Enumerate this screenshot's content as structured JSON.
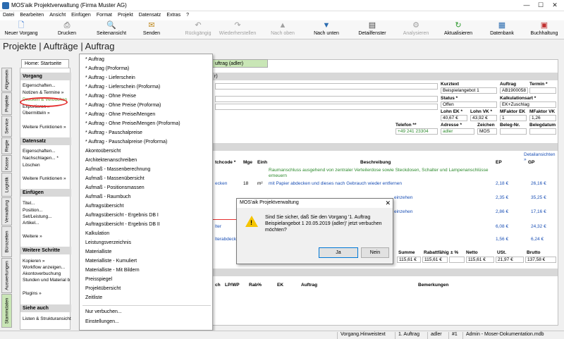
{
  "window": {
    "title": "MOS'aik Projektverwaltung (Firma Muster AG)",
    "minimize": "—",
    "maximize": "☐",
    "close": "✕"
  },
  "menubar": [
    "Datei",
    "Bearbeiten",
    "Ansicht",
    "Einfügen",
    "Format",
    "Projekt",
    "Datensatz",
    "Extras",
    "?"
  ],
  "toolbar": [
    {
      "label": "Neuer Vorgang",
      "icon": "new-document-icon",
      "enabled": true
    },
    {
      "label": "Drucken",
      "icon": "printer-icon",
      "enabled": true
    },
    {
      "label": "Seitenansicht",
      "icon": "print-preview-icon",
      "enabled": true
    },
    {
      "label": "Senden",
      "icon": "send-mail-icon",
      "enabled": true
    },
    {
      "label": "Rückgängig",
      "icon": "undo-icon",
      "enabled": false
    },
    {
      "label": "Wiederherstellen",
      "icon": "redo-icon",
      "enabled": false
    },
    {
      "label": "Nach oben",
      "icon": "arrow-up-icon",
      "enabled": false
    },
    {
      "label": "Nach unten",
      "icon": "arrow-down-icon",
      "enabled": true
    },
    {
      "label": "Detailfenster",
      "icon": "detail-window-icon",
      "enabled": true
    },
    {
      "label": "Analysieren",
      "icon": "analyze-icon",
      "enabled": false
    },
    {
      "label": "Aktualisieren",
      "icon": "refresh-icon",
      "enabled": true
    },
    {
      "label": "Datenbank",
      "icon": "database-icon",
      "enabled": true
    },
    {
      "label": "Buchhaltung",
      "icon": "accounting-icon",
      "enabled": true
    }
  ],
  "page_title": "Projekte | Aufträge | Auftrag",
  "home_tab": "Home: Startseite",
  "doc_tab": "uftrag (adler)",
  "side_tabs": [
    "Allgemein",
    "Projekte",
    "Service",
    "Regie",
    "Kasse",
    "Logistik",
    "Verwaltung",
    "Bürozeiten",
    "Auswertungen",
    "Stammdaten"
  ],
  "nav": {
    "vorgang_head": "Vorgang",
    "vorgang_items": [
      "Eigenschaften...",
      "Notizen & Termine »",
      "Drucken & Verbuchen",
      "Exportieren »",
      "Übermitteln »"
    ],
    "vorgang_more": "Weitere Funktionen »",
    "datensatz_head": "Datensatz",
    "datensatz_items": [
      "Eigenschaften...",
      "Nachschlagen... *",
      "Löschen"
    ],
    "datensatz_more": "Weitere Funktionen »",
    "einfuegen_head": "Einfügen",
    "einfuegen_items": [
      "Titel...",
      "Position...",
      "Set/Leistung...",
      "Artikel..."
    ],
    "einfuegen_more": "Weitere »",
    "schritte_head": "Weitere Schritte",
    "schritte_items": [
      "Kopieren »",
      "Workflow anzeigen...",
      "Akontoverbuchung",
      "Stunden und Material b"
    ],
    "schritte_more": "Plugins »",
    "siehe_head": "Siehe auch",
    "siehe_items": [
      "Listen & Strukturansicht"
    ]
  },
  "context_menu": {
    "items": [
      "* Auftrag",
      "* Auftrag (Proforma)",
      "* Auftrag - Lieferschein",
      "* Auftrag - Lieferschein (Proforma)",
      "* Auftrag - Ohne Preise",
      "* Auftrag - Ohne Preise (Proforma)",
      "* Auftrag - Ohne Preise/Mengen",
      "* Auftrag - Ohne Preise/Mengen (Proforma)",
      "* Auftrag - Pauschalpreise",
      "* Auftrag - Pauschalpreise (Proforma)",
      "Akontoübersicht",
      "Architektenanschreiben",
      "Aufmaß - Massenberechnung",
      "Aufmaß - Massenübersicht",
      "Aufmaß - Positionsmassen",
      "Aufmaß - Raumbuch",
      "Auftragsübersicht",
      "Auftragsübersicht - Ergebnis DB I",
      "Auftragsübersicht - Ergebnis DB II",
      "Kalkulation",
      "Leistungsverzeichnis",
      "Materialliste",
      "Materialliste - Kumuliert",
      "Materialliste - Mit Bildern",
      "Preisspiegel",
      "Projektübersicht",
      "Zeitliste"
    ],
    "extra": [
      "Nur verbuchen...",
      "Einstellungen..."
    ]
  },
  "header": {
    "section": "r)",
    "kurztext_label": "Kurztext",
    "kurztext": "Beispielangebot 1",
    "auftrag_label": "Auftrag",
    "auftrag": "AB1900058",
    "termin_label": "Termin *",
    "status_label": "Status *",
    "status": "Offen",
    "kalk_label": "Kalkulationsart *",
    "kalk": "EK+Zuschlag",
    "lohn_ek_label": "Lohn EK *",
    "lohn_ek": "40,67 €",
    "lohn_vk_label": "Lohn VK *",
    "lohn_vk": "43,92 €",
    "mf_ek_label": "MFaktor EK",
    "mf_ek": "1",
    "mf_vk_label": "MFaktor VK",
    "mf_vk": "1,26",
    "telefon_label": "Telefon **",
    "telefon": "+49 241 23304",
    "adresse_label": "Adresse *",
    "adresse": "adler",
    "zeichen_label": "Zeichen",
    "zeichen": "MOS",
    "beleg_label": "Beleg-Nr.",
    "belegdatum_label": "Belegdatum"
  },
  "positions": {
    "details_link": "Detailansichten »",
    "columns": [
      "tchcode *",
      "Mge",
      "Einh",
      "Beschreibung",
      "EP",
      "GP"
    ],
    "rows": [
      {
        "code": "",
        "mge": "",
        "einh": "",
        "desc": "Raumanschluss ausgehend von zentraler Verteilerdose sowie Steckdosen, Schalter und Lampenanschlüsse erneuern",
        "ep": "",
        "gp": "",
        "green": true
      },
      {
        "code": "ecken",
        "mge": "18",
        "einh": "m²",
        "desc": "mit Papier abdecken und dieses nach Gebrauch wieder entfernen",
        "ep": "2,18 €",
        "gp": "26,16 €",
        "green": false
      },
      {
        "code": "",
        "mge": "",
        "einh": "",
        "desc": "einzehen",
        "ep": "2,35 €",
        "gp": "35,25 €",
        "green": false
      },
      {
        "code": "",
        "mge": "",
        "einh": "",
        "desc": "einzehen",
        "ep": "2,86 €",
        "gp": "17,16 €",
        "green": false
      },
      {
        "code": "lter",
        "mge": "",
        "einh": "",
        "desc": "",
        "ep": "6,08 €",
        "gp": "24,32 €",
        "green": false
      },
      {
        "code": "lterabdeck",
        "mge": "",
        "einh": "",
        "desc": "",
        "ep": "1,56 €",
        "gp": "6,24 €",
        "green": false
      }
    ]
  },
  "totals": {
    "labels": [
      "Summe",
      "Rabattfähig",
      "± %",
      "Netto",
      "USt.",
      "Brutto"
    ],
    "values": [
      "115,61 €",
      "115,61 €",
      "",
      "115,61 €",
      "21,97 €",
      "137,58 €"
    ]
  },
  "bottom_table": {
    "columns": [
      "ch",
      "LP/WP",
      "Rab%",
      "EK",
      "Auftrag",
      "Bemerkungen"
    ]
  },
  "dialog": {
    "title": "MOS'aik Projektverwaltung",
    "message": "Sind Sie sicher, daß Sie den Vorgang '1. Auftrag Beispielangebot 1 20.05.2019 (adler)' jetzt verbuchen möchten?",
    "yes": "Ja",
    "no": "Nein"
  },
  "statusbar": [
    "Vorgang.Hinweistext",
    "1. Auftrag",
    "adler",
    "#1",
    "Admin - Moser-Dokumentation.mdb"
  ]
}
